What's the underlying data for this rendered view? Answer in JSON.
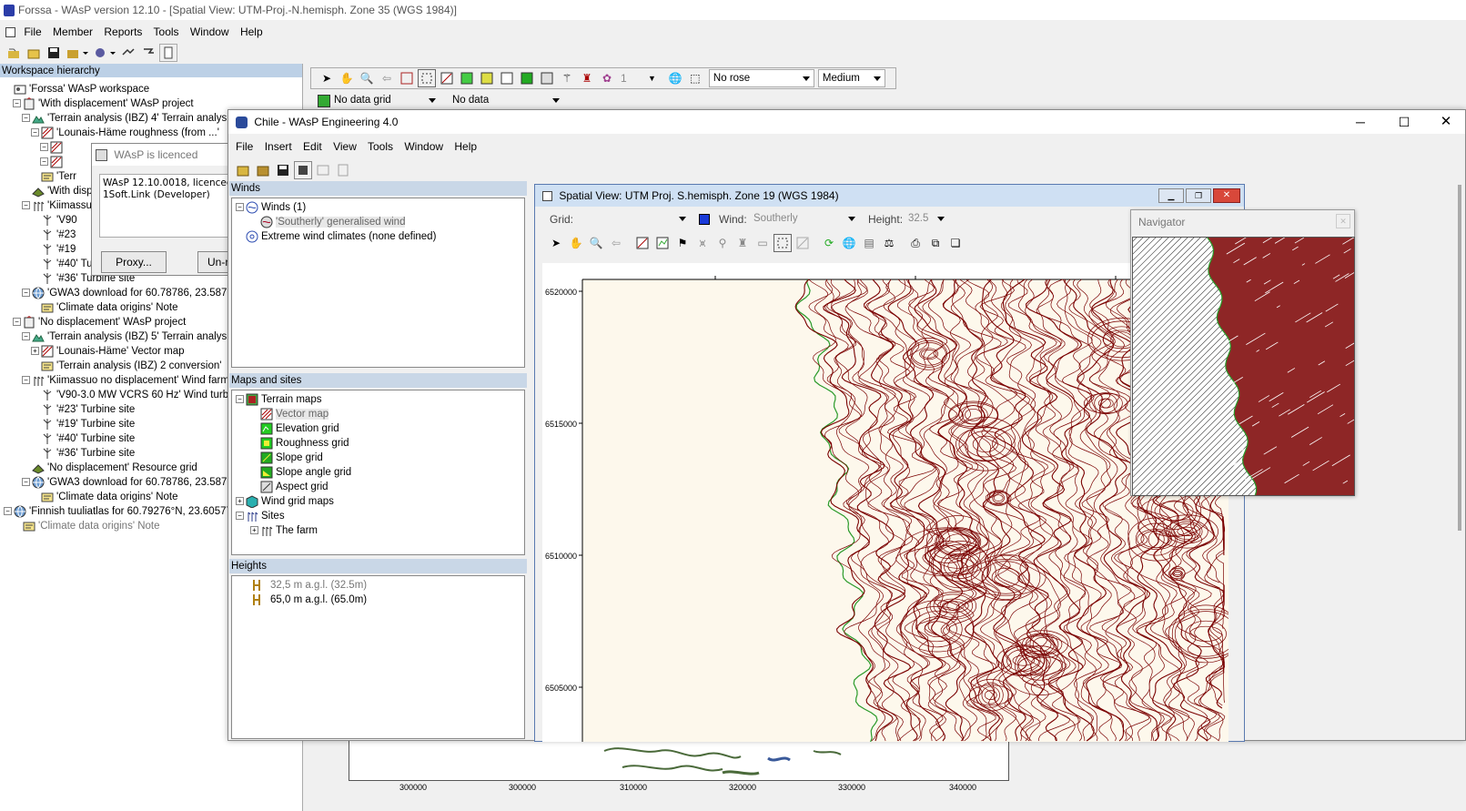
{
  "main": {
    "title": "Forssa - WAsP version 12.10 - [Spatial View: UTM-Proj.-N.hemisph. Zone 35 (WGS 1984)]",
    "menu": [
      "File",
      "Member",
      "Reports",
      "Tools",
      "Window",
      "Help"
    ],
    "workspace_header": "Workspace hierarchy",
    "tree": [
      {
        "indent": 0,
        "exp": "",
        "text": "'Forssa' WAsP workspace",
        "icon": "workspace-icon"
      },
      {
        "indent": 1,
        "exp": "−",
        "text": "'With displacement' WAsP project",
        "icon": "project-icon"
      },
      {
        "indent": 2,
        "exp": "−",
        "text": "'Terrain analysis (IBZ) 4' Terrain analysis",
        "icon": "terrain-icon"
      },
      {
        "indent": 3,
        "exp": "−",
        "text": "'Lounais-Häme roughness (from ...'",
        "icon": "map-icon"
      },
      {
        "indent": 4,
        "exp": "−",
        "text": "",
        "icon": "map-icon"
      },
      {
        "indent": 4,
        "exp": "−",
        "text": "",
        "icon": "map-icon"
      },
      {
        "indent": 3,
        "exp": "",
        "text": "'Terr",
        "icon": "note-icon"
      },
      {
        "indent": 2,
        "exp": "",
        "text": "'With disp",
        "icon": "grid-icon"
      },
      {
        "indent": 2,
        "exp": "−",
        "text": "'Kiimassuo",
        "icon": "farm-icon"
      },
      {
        "indent": 3,
        "exp": "",
        "text": "'V90",
        "icon": "turbine-icon"
      },
      {
        "indent": 3,
        "exp": "",
        "text": "'#23",
        "icon": "turbine-icon"
      },
      {
        "indent": 3,
        "exp": "",
        "text": "'#19",
        "icon": "turbine-icon"
      },
      {
        "indent": 3,
        "exp": "",
        "text": "'#40' Turbine site",
        "icon": "turbine-icon"
      },
      {
        "indent": 3,
        "exp": "",
        "text": "'#36' Turbine site",
        "icon": "turbine-icon"
      },
      {
        "indent": 2,
        "exp": "−",
        "text": "'GWA3 download for 60.78786, 23.5876",
        "icon": "globe-icon"
      },
      {
        "indent": 3,
        "exp": "",
        "text": "'Climate data origins' Note",
        "icon": "note-icon"
      },
      {
        "indent": 1,
        "exp": "−",
        "text": "'No displacement' WAsP project",
        "icon": "project-icon"
      },
      {
        "indent": 2,
        "exp": "−",
        "text": "'Terrain analysis (IBZ) 5' Terrain analysis",
        "icon": "terrain-icon"
      },
      {
        "indent": 3,
        "exp": "+",
        "text": "'Lounais-Häme' Vector map",
        "icon": "map-icon"
      },
      {
        "indent": 3,
        "exp": "",
        "text": "'Terrain analysis (IBZ) 2 conversion'",
        "icon": "note-icon"
      },
      {
        "indent": 2,
        "exp": "−",
        "text": "'Kiimassuo no displacement' Wind farm (4",
        "icon": "farm-icon"
      },
      {
        "indent": 3,
        "exp": "",
        "text": "'V90-3.0 MW VCRS 60 Hz' Wind turbi",
        "icon": "turbine-icon"
      },
      {
        "indent": 3,
        "exp": "",
        "text": "'#23' Turbine site",
        "icon": "turbine-icon"
      },
      {
        "indent": 3,
        "exp": "",
        "text": "'#19' Turbine site",
        "icon": "turbine-icon"
      },
      {
        "indent": 3,
        "exp": "",
        "text": "'#40' Turbine site",
        "icon": "turbine-icon"
      },
      {
        "indent": 3,
        "exp": "",
        "text": "'#36' Turbine site",
        "icon": "turbine-icon"
      },
      {
        "indent": 2,
        "exp": "",
        "text": "'No displacement' Resource grid",
        "icon": "grid-icon"
      },
      {
        "indent": 2,
        "exp": "−",
        "text": "'GWA3 download for 60.78786, 23.5876",
        "icon": "globe-icon"
      },
      {
        "indent": 3,
        "exp": "",
        "text": "'Climate data origins' Note",
        "icon": "note-icon"
      },
      {
        "indent": 0,
        "exp": "−",
        "text": "'Finnish tuuliatlas for 60.79276°N, 23.60577'",
        "icon": "globe-icon"
      },
      {
        "indent": 1,
        "exp": "",
        "text": "'Climate data origins' Note",
        "icon": "note-icon",
        "grey": true
      }
    ],
    "licence": {
      "title": "WAsP is licenced",
      "text": "WAsP 12.10.0018, licenced to\n1Soft.Link (Developer)",
      "proxy": "Proxy...",
      "unreg": "Un-re"
    },
    "toolbar2": {
      "count": "1",
      "rose": "No rose",
      "size": "Medium",
      "grid": "No data grid",
      "data": "No data"
    },
    "bottom_ticks": [
      "300000",
      "300000",
      "310000",
      "320000",
      "330000",
      "340000"
    ]
  },
  "chile": {
    "title": "Chile - WAsP Engineering 4.0",
    "menu": [
      "File",
      "Insert",
      "Edit",
      "View",
      "Tools",
      "Window",
      "Help"
    ],
    "winds_header": "Winds",
    "winds": [
      {
        "indent": 0,
        "exp": "−",
        "text": "Winds (1)",
        "icon": "wind-icon"
      },
      {
        "indent": 1,
        "exp": "",
        "text": "'Southerly' generalised wind",
        "icon": "wind-item-icon",
        "sel": true
      },
      {
        "indent": 0,
        "exp": "",
        "text": "Extreme wind climates (none defined)",
        "icon": "extreme-icon"
      }
    ],
    "maps_header": "Maps and sites",
    "maps": [
      {
        "indent": 0,
        "exp": "−",
        "text": "Terrain maps",
        "icon": "terrain-maps-icon"
      },
      {
        "indent": 1,
        "exp": "",
        "text": "Vector map",
        "icon": "vector-map-icon",
        "sel": true
      },
      {
        "indent": 1,
        "exp": "",
        "text": "Elevation grid",
        "icon": "elevation-grid-icon"
      },
      {
        "indent": 1,
        "exp": "",
        "text": "Roughness grid",
        "icon": "roughness-grid-icon"
      },
      {
        "indent": 1,
        "exp": "",
        "text": "Slope grid",
        "icon": "slope-grid-icon"
      },
      {
        "indent": 1,
        "exp": "",
        "text": "Slope angle grid",
        "icon": "slope-angle-grid-icon"
      },
      {
        "indent": 1,
        "exp": "",
        "text": "Aspect grid",
        "icon": "aspect-grid-icon"
      },
      {
        "indent": 0,
        "exp": "+",
        "text": "Wind grid maps",
        "icon": "wind-grid-icon"
      },
      {
        "indent": 0,
        "exp": "−",
        "text": "Sites",
        "icon": "sites-icon"
      },
      {
        "indent": 1,
        "exp": "+",
        "text": "The farm",
        "icon": "farm-icon"
      }
    ],
    "heights_header": "Heights",
    "heights": [
      {
        "text": "32,5 m a.g.l. (32.5m)",
        "sel": true
      },
      {
        "text": "65,0 m a.g.l. (65.0m)"
      }
    ]
  },
  "spatial": {
    "title": "Spatial View: UTM Proj. S.hemisph. Zone 19 (WGS 1984)",
    "grid_label": "Grid:",
    "grid_value": "",
    "wind_label": "Wind:",
    "wind_value": "Southerly",
    "height_label": "Height:",
    "height_value": "32.5",
    "y_ticks": [
      "6520000",
      "6515000",
      "6510000",
      "6505000"
    ]
  },
  "navigator": {
    "title": "Navigator"
  },
  "colors": {
    "contour": "#7a0000",
    "map_bg": "#fdf8ec",
    "coast": "#2a9a2a",
    "panel_header": "#c9d7e7",
    "title_active": "#cfe0f3"
  }
}
